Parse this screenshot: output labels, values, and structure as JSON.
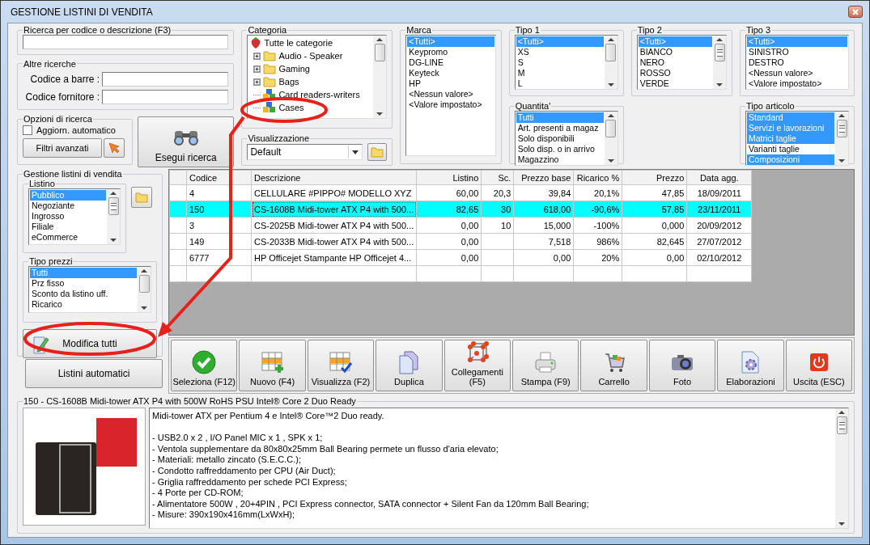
{
  "window": {
    "title": "GESTIONE LISTINI DI VENDITA"
  },
  "search": {
    "label": "Ricerca per codice o descrizione (F3)"
  },
  "other_search": {
    "label": "Altre ricerche",
    "fields": [
      {
        "label": "Codice a barre :"
      },
      {
        "label": "Codice fornitore :"
      }
    ]
  },
  "search_options": {
    "label": "Opzioni di ricerca",
    "checkbox": {
      "label": "Aggiorn. automatico",
      "checked": false
    },
    "advanced_button": "Filtri avanzati"
  },
  "search_button": "Esegui ricerca",
  "category": {
    "label": "Categoria",
    "items": [
      {
        "label": "Tutte le categorie",
        "kind": "root"
      },
      {
        "label": "Audio - Speaker",
        "kind": "folder",
        "expanded": false
      },
      {
        "label": "Gaming",
        "kind": "folder",
        "expanded": false
      },
      {
        "label": "Bags",
        "kind": "folder",
        "expanded": false
      },
      {
        "label": "Card readers-writers",
        "kind": "leaf"
      },
      {
        "label": "Cases",
        "kind": "leaf"
      }
    ]
  },
  "view": {
    "label": "Visualizzazione",
    "value": "Default"
  },
  "brand": {
    "label": "Marca",
    "items": [
      {
        "label": "<Tutti>",
        "selected": true
      },
      {
        "label": "Keypromo",
        "selected": false
      },
      {
        "label": "DG-LINE",
        "selected": false
      },
      {
        "label": "Keyteck",
        "selected": false
      },
      {
        "label": "HP",
        "selected": false
      },
      {
        "label": "<Nessun valore>",
        "selected": false
      },
      {
        "label": "<Valore impostato>",
        "selected": false
      }
    ]
  },
  "type1": {
    "label": "Tipo 1",
    "items": [
      {
        "label": "<Tutti>",
        "selected": true
      },
      {
        "label": "XS",
        "selected": false
      },
      {
        "label": "S",
        "selected": false
      },
      {
        "label": "M",
        "selected": false
      },
      {
        "label": "L",
        "selected": false
      }
    ]
  },
  "quantity": {
    "label": "Quantita'",
    "items": [
      {
        "label": "Tutti",
        "selected": true
      },
      {
        "label": "Art. presenti a magaz",
        "selected": false
      },
      {
        "label": "Solo disponibili",
        "selected": false
      },
      {
        "label": "Solo disp. o in arrivo",
        "selected": false
      },
      {
        "label": "Magazzino",
        "selected": false
      }
    ]
  },
  "type2": {
    "label": "Tipo 2",
    "items": [
      {
        "label": "<Tutti>",
        "selected": true
      },
      {
        "label": "BIANCO",
        "selected": false
      },
      {
        "label": "NERO",
        "selected": false
      },
      {
        "label": "ROSSO",
        "selected": false
      },
      {
        "label": "VERDE",
        "selected": false
      }
    ]
  },
  "type3": {
    "label": "Tipo 3",
    "items": [
      {
        "label": "<Tutti>",
        "selected": true
      },
      {
        "label": "SINISTRO",
        "selected": false
      },
      {
        "label": "DESTRO",
        "selected": false
      },
      {
        "label": "<Nessun valore>",
        "selected": false
      },
      {
        "label": "<Valore impostato>",
        "selected": false
      }
    ]
  },
  "article_type": {
    "label": "Tipo articolo",
    "items": [
      {
        "label": "Standard",
        "selected": true
      },
      {
        "label": "Servizi e lavorazioni",
        "selected": true
      },
      {
        "label": "Matrici taglie",
        "selected": true
      },
      {
        "label": "Varianti taglie",
        "selected": false
      },
      {
        "label": "Composizioni",
        "selected": true
      }
    ]
  },
  "price_lists": {
    "label": "Gestione listini di vendita",
    "list": {
      "label": "Listino",
      "items": [
        {
          "label": "Pubblico",
          "selected": true
        },
        {
          "label": "Negoziante",
          "selected": false
        },
        {
          "label": "Ingrosso",
          "selected": false
        },
        {
          "label": "Filiale",
          "selected": false
        },
        {
          "label": "eCommerce",
          "selected": false
        }
      ]
    },
    "price_types": {
      "label": "Tipo prezzi",
      "items": [
        {
          "label": "Tutti",
          "selected": true
        },
        {
          "label": "Prz fisso",
          "selected": false
        },
        {
          "label": "Sconto da listino uff.",
          "selected": false
        },
        {
          "label": "Ricarico",
          "selected": false
        }
      ]
    },
    "edit_all_button": "Modifica tutti"
  },
  "auto_lists_button": "Listini automatici",
  "table": {
    "columns": [
      "Codice",
      "Descrizione",
      "Listino",
      "Sc.",
      "Prezzo base",
      "Ricarico %",
      "Prezzo",
      "Data agg."
    ],
    "rows": [
      {
        "cells": [
          "4",
          "CELLULARE #PIPPO# MODELLO XYZ",
          "60,00",
          "20,3",
          "39,84",
          "20,1%",
          "47,85",
          "18/09/2011"
        ],
        "selected": false
      },
      {
        "cells": [
          "150",
          "CS-1608B Midi-tower ATX P4 with 500...",
          "82,65",
          "30",
          "618,00",
          "-90,6%",
          "57,85",
          "23/11/2011"
        ],
        "selected": true
      },
      {
        "cells": [
          "3",
          "CS-2025B Midi-tower ATX P4 with 500...",
          "0,00",
          "10",
          "15,000",
          "-100%",
          "0,000",
          "20/09/2012"
        ],
        "selected": false
      },
      {
        "cells": [
          "149",
          "CS-2033B Midi-tower ATX P4 with 500...",
          "0,00",
          null,
          "7,518",
          "986%",
          "82,645",
          "27/07/2012"
        ],
        "selected": false
      },
      {
        "cells": [
          "6777",
          "HP Officejet Stampante HP Officejet 4...",
          "0,00",
          null,
          "0,00",
          "20%",
          "0,00",
          "02/10/2012"
        ],
        "selected": false
      }
    ]
  },
  "toolbar": [
    {
      "label": "Seleziona (F12)",
      "kind": "check"
    },
    {
      "label": "Nuovo (F4)",
      "kind": "new"
    },
    {
      "label": "Visualizza (F2)",
      "kind": "view"
    },
    {
      "label": "Duplica",
      "kind": "copy"
    },
    {
      "label": "Collegamenti (F5)",
      "kind": "links"
    },
    {
      "label": "Stampa (F9)",
      "kind": "print"
    },
    {
      "label": "Carrello",
      "kind": "cart"
    },
    {
      "label": "Foto",
      "kind": "camera"
    },
    {
      "label": "Elaborazioni",
      "kind": "process"
    },
    {
      "label": "Uscita (ESC)",
      "kind": "exit"
    }
  ],
  "detail": {
    "title": "150 - CS-1608B Midi-tower ATX P4 with 500W RoHS PSU Intel® Core 2 Duo Ready",
    "intro": "Midi-tower ATX per Pentium 4 e Intel® Core™2 Duo ready.",
    "lines": [
      "- USB2.0 x 2 , I/O Panel MIC x 1 , SPK x 1;",
      "- Ventola supplementare da 80x80x25mm Ball Bearing permete un flusso d'aria elevato;",
      "- Materiali: metallo zincato (S.E.C.C.);",
      "- Condotto raffreddamento per CPU (Air Duct);",
      "- Griglia raffreddamento per schede PCI Express;",
      "- 4 Porte per CD-ROM;",
      "- Alimentatore 500W , 20+4PIN , PCI Express connector, SATA connector + Silent Fan da 120mm Ball Bearing;",
      "- Misure: 390x190x416mm(LxWxH);"
    ]
  }
}
